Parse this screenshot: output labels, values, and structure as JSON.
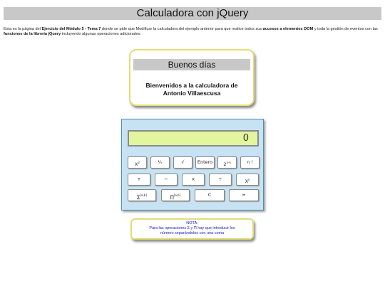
{
  "page": {
    "title": "Calculadora con jQuery",
    "intro_1": "Esta es la página del ",
    "intro_b1": "Ejercicio del Módulo 5 - Tema 7",
    "intro_2": " donde se pide que Modificar la calculadora del ejemplo anterior para que realice todos sus ",
    "intro_b2": "accesos a elementos DOM",
    "intro_3": " y toda la gestión de eventos con las ",
    "intro_b3": "funciones de la librería jQuery",
    "intro_4": " incluyendo algunas operaciones adicionales."
  },
  "greeting": {
    "title": "Buenos días",
    "line1": "Bienvenidos a la calculadora de",
    "line2": "Antonio Villaescusa"
  },
  "calculator": {
    "display": "0",
    "row1": [
      {
        "base": "X",
        "sup": "2"
      },
      {
        "base": "¹⁄ₓ",
        "sup": ""
      },
      {
        "base": "√",
        "sup": ""
      },
      {
        "base": "Entero",
        "sup": ""
      },
      {
        "base": "2",
        "sup": "x·n"
      },
      {
        "base": "n !",
        "sup": ""
      }
    ],
    "row2": [
      {
        "base": "+",
        "sup": ""
      },
      {
        "base": "−",
        "sup": ""
      },
      {
        "base": "×",
        "sup": ""
      },
      {
        "base": "÷",
        "sup": ""
      },
      {
        "base": "X",
        "sup": "y"
      }
    ],
    "row3": [
      {
        "base": "∑",
        "sup": "[a,b]"
      },
      {
        "base": "∏",
        "sup": "[a,b]"
      },
      {
        "base": "C",
        "sup": ""
      },
      {
        "base": "=",
        "sup": ""
      }
    ]
  },
  "note": {
    "line1": "NOTA:",
    "line2": "Para las operaciones Σ y Π hay que introducir los",
    "line3": "número separándolos con una coma"
  }
}
